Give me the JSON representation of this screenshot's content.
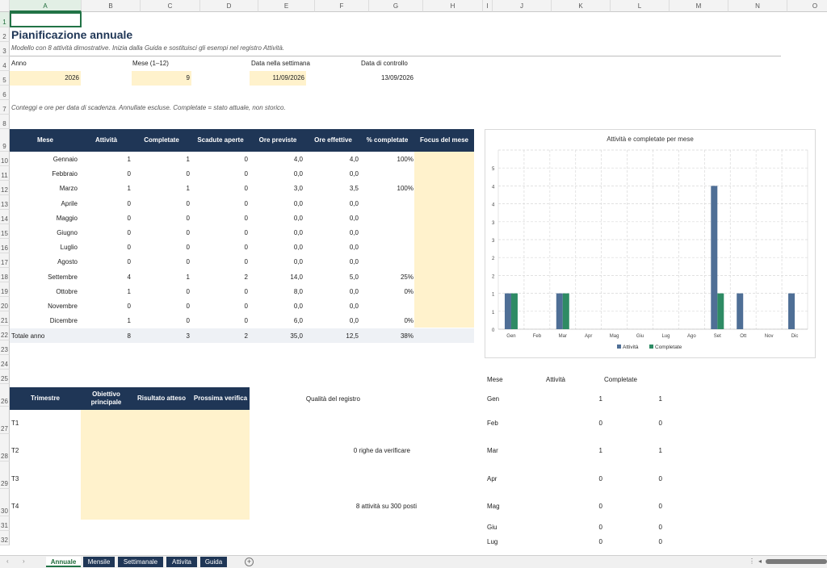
{
  "columns": [
    "A",
    "B",
    "C",
    "D",
    "E",
    "F",
    "G",
    "H",
    "I",
    "J",
    "K",
    "L",
    "M",
    "N",
    "O"
  ],
  "rows": [
    "1",
    "2",
    "3",
    "4",
    "5",
    "6",
    "7",
    "8",
    "9",
    "10",
    "11",
    "12",
    "13",
    "14",
    "15",
    "16",
    "17",
    "18",
    "19",
    "20",
    "21",
    "22",
    "23",
    "24",
    "25",
    "26",
    "27",
    "28",
    "29",
    "30",
    "31",
    "32"
  ],
  "title": "Pianificazione annuale",
  "subtitle": "Modello con 8 attività dimostrative. Inizia dalla Guida e sostituisci gli esempi nel registro Attività.",
  "params": {
    "anno_label": "Anno",
    "anno_value": "2026",
    "mese_label": "Mese (1–12)",
    "mese_value": "9",
    "data_sett_label": "Data nella settimana",
    "data_sett_value": "11/09/2026",
    "data_ctrl_label": "Data di controllo",
    "data_ctrl_value": "13/09/2026"
  },
  "note": "Conteggi e ore per data di scadenza. Annullate escluse. Completate = stato attuale, non storico.",
  "table": {
    "headers": [
      "Mese",
      "Attività",
      "Completate",
      "Scadute aperte",
      "Ore previste",
      "Ore effettive",
      "% completate",
      "Focus del mese"
    ],
    "rows": [
      [
        "Gennaio",
        "1",
        "1",
        "0",
        "4,0",
        "4,0",
        "100%"
      ],
      [
        "Febbraio",
        "0",
        "0",
        "0",
        "0,0",
        "0,0",
        ""
      ],
      [
        "Marzo",
        "1",
        "1",
        "0",
        "3,0",
        "3,5",
        "100%"
      ],
      [
        "Aprile",
        "0",
        "0",
        "0",
        "0,0",
        "0,0",
        ""
      ],
      [
        "Maggio",
        "0",
        "0",
        "0",
        "0,0",
        "0,0",
        ""
      ],
      [
        "Giugno",
        "0",
        "0",
        "0",
        "0,0",
        "0,0",
        ""
      ],
      [
        "Luglio",
        "0",
        "0",
        "0",
        "0,0",
        "0,0",
        ""
      ],
      [
        "Agosto",
        "0",
        "0",
        "0",
        "0,0",
        "0,0",
        ""
      ],
      [
        "Settembre",
        "4",
        "1",
        "2",
        "14,0",
        "5,0",
        "25%"
      ],
      [
        "Ottobre",
        "1",
        "0",
        "0",
        "8,0",
        "0,0",
        "0%"
      ],
      [
        "Novembre",
        "0",
        "0",
        "0",
        "0,0",
        "0,0",
        ""
      ],
      [
        "Dicembre",
        "1",
        "0",
        "0",
        "6,0",
        "0,0",
        "0%"
      ]
    ],
    "total": [
      "Totale anno",
      "8",
      "3",
      "2",
      "35,0",
      "12,5",
      "38%"
    ]
  },
  "quarters": {
    "headers": [
      "Trimestre",
      "Obiettivo principale",
      "Risultato atteso",
      "Prossima verifica"
    ],
    "rows": [
      "T1",
      "T2",
      "T3",
      "T4"
    ]
  },
  "quality": {
    "label": "Qualità del registro",
    "rows_to_check": "0 righe da verificare",
    "capacity": "8 attività su 300 posti"
  },
  "side_table": {
    "headers": [
      "Mese",
      "Attività",
      "Completate"
    ],
    "rows": [
      [
        "Gen",
        "1",
        "1"
      ],
      [
        "Feb",
        "0",
        "0"
      ],
      [
        "Mar",
        "1",
        "1"
      ],
      [
        "Apr",
        "0",
        "0"
      ],
      [
        "Mag",
        "0",
        "0"
      ],
      [
        "Giu",
        "0",
        "0"
      ],
      [
        "Lug",
        "0",
        "0"
      ]
    ]
  },
  "chart_data": {
    "type": "bar",
    "title": "Attività e completate per mese",
    "categories": [
      "Gen",
      "Feb",
      "Mar",
      "Apr",
      "Mag",
      "Giu",
      "Lug",
      "Ago",
      "Set",
      "Ott",
      "Nov",
      "Dic"
    ],
    "series": [
      {
        "name": "Attività",
        "values": [
          1,
          0,
          1,
          0,
          0,
          0,
          0,
          0,
          4,
          1,
          0,
          1
        ],
        "color": "#4f6f96"
      },
      {
        "name": "Completate",
        "values": [
          1,
          0,
          1,
          0,
          0,
          0,
          0,
          0,
          1,
          0,
          0,
          0
        ],
        "color": "#2e8b64"
      }
    ],
    "ylim": [
      0,
      5
    ],
    "yticks": [
      "0",
      "1",
      "1",
      "2",
      "2",
      "3",
      "3",
      "4",
      "4",
      "5"
    ],
    "ytick_values": [
      0,
      0.5,
      1,
      1.5,
      2,
      2.5,
      3,
      3.5,
      4,
      4.5
    ],
    "grid": true,
    "legend": "bottom"
  },
  "tabs": [
    "Annuale",
    "Mensile",
    "Settimanale",
    "Attivita",
    "Guida"
  ],
  "active_tab": "Annuale"
}
